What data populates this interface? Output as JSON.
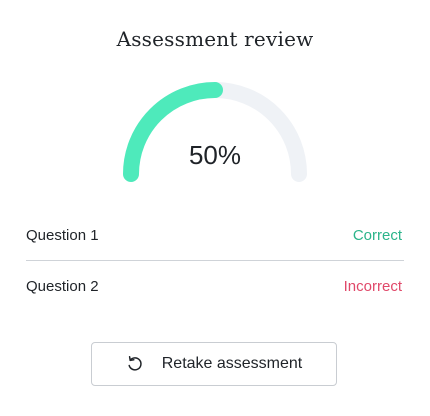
{
  "title": "Assessment review",
  "score": {
    "label": "50%",
    "fraction": 0.5,
    "fill_color": "#4eeabb",
    "track_color": "#eff2f6"
  },
  "results": [
    {
      "question": "Question 1",
      "status": "Correct",
      "status_color": "#2bb48a"
    },
    {
      "question": "Question 2",
      "status": "Incorrect",
      "status_color": "#e0496a"
    }
  ],
  "retake_button": {
    "label": "Retake assessment",
    "icon": "retake-icon"
  }
}
